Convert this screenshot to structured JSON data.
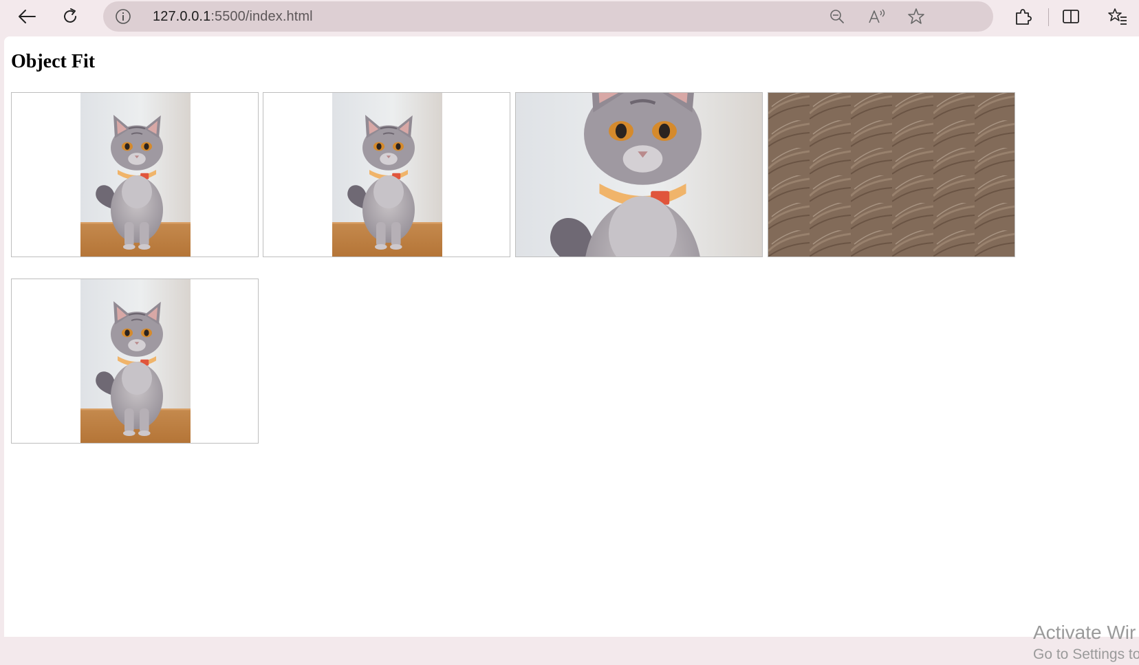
{
  "browser": {
    "url": {
      "host": "127.0.0.1",
      "path": ":5500/index.html"
    },
    "icons": {
      "back": "back-arrow-icon",
      "reload": "reload-icon",
      "site_info": "info-icon",
      "zoom": "zoom-out-icon",
      "read_aloud": "read-aloud-icon",
      "favorite": "star-icon",
      "extensions": "puzzle-icon",
      "split_screen": "split-screen-icon",
      "favorites": "favorites-list-icon"
    }
  },
  "page": {
    "heading": "Object Fit",
    "images": [
      {
        "alt": "cat",
        "fit": "fill"
      },
      {
        "alt": "cat",
        "fit": "contain"
      },
      {
        "alt": "cat",
        "fit": "cover"
      },
      {
        "alt": "cat",
        "fit": "none"
      },
      {
        "alt": "cat",
        "fit": "scale-down"
      }
    ]
  },
  "os_watermark": {
    "line1": "Activate Wir",
    "line2": "Go to Settings to"
  },
  "colors": {
    "chrome_bg": "#f3e9ec",
    "address_bar_bg": "#ddcfd3",
    "page_bg": "#ffffff",
    "frame_border": "#bdbdbd"
  }
}
